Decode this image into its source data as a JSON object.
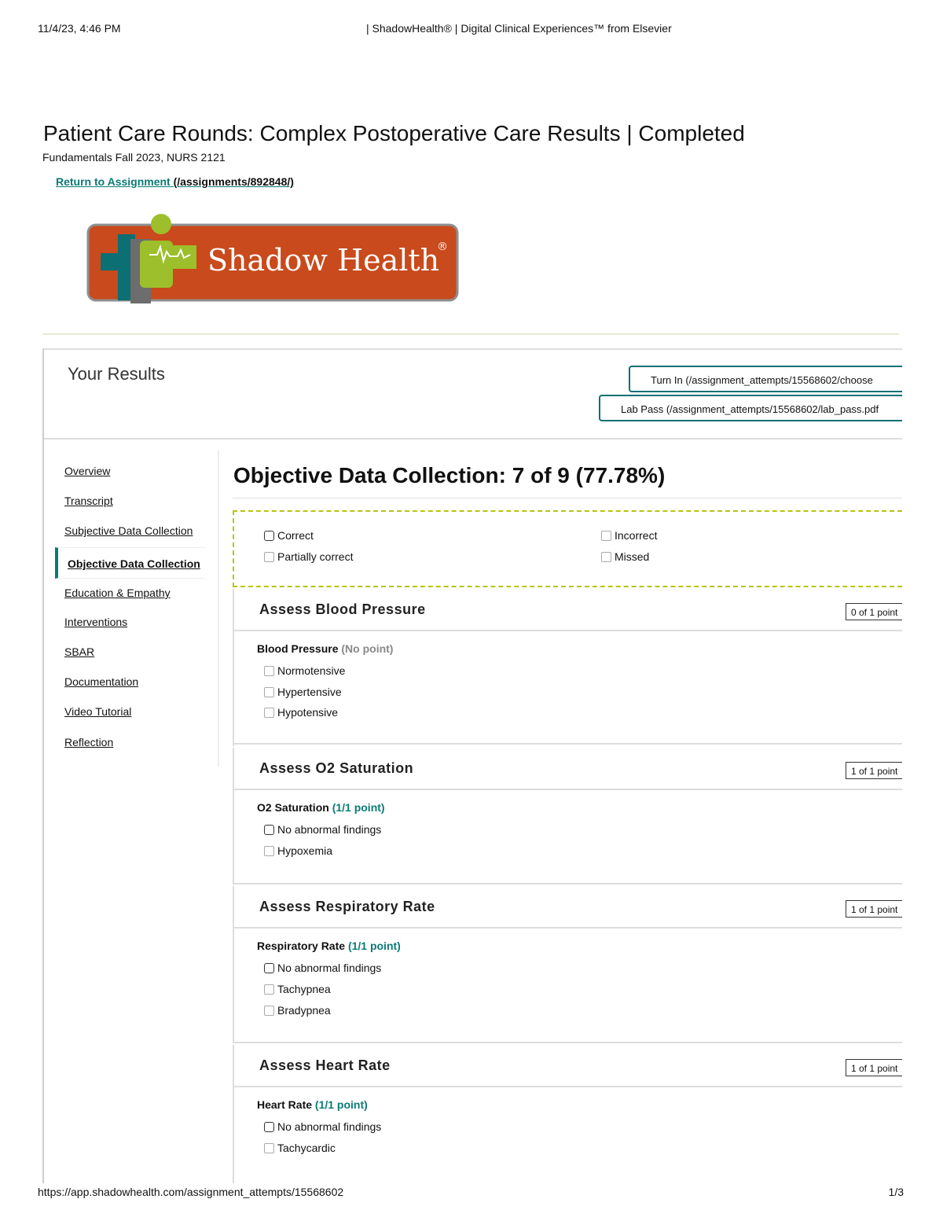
{
  "pdf_header": {
    "datetime": "11/4/23, 4:46 PM",
    "title": "| ShadowHealth® | Digital Clinical Experiences™ from Elsevier"
  },
  "pdf_footer": {
    "url": "https://app.shadowhealth.com/assignment_attempts/15568602",
    "page": "1/3"
  },
  "page": {
    "title": "Patient Care Rounds: Complex Postoperative Care Results | Completed",
    "course": "Fundamentals Fall 2023, NURS 2121",
    "return_link": {
      "label": "Return to Assignment",
      "href": " (/assignments/892848/)"
    }
  },
  "logo": {
    "text": "Shadow Health",
    "mark": "®",
    "colors": {
      "orange": "#c94a1c",
      "green": "#9cbf2b",
      "teal": "#0b6f73"
    }
  },
  "results": {
    "heading": "Your Results",
    "turn_in_button": "Turn In (/assignment_attempts/15568602/choose",
    "lab_pass_button": "Lab Pass (/assignment_attempts/15568602/lab_pass.pdf"
  },
  "nav": {
    "items": [
      "Overview",
      "Transcript",
      "Subjective Data Collection",
      "Objective Data Collection",
      "Education & Empathy",
      "Interventions",
      "SBAR",
      "Documentation",
      "Video Tutorial",
      "Reflection"
    ],
    "active": "Objective Data Collection"
  },
  "section": {
    "title": "Objective Data Collection: 7 of 9 (77.78%)"
  },
  "legend": {
    "correct": "Correct",
    "partially_correct": "Partially correct",
    "incorrect": "Incorrect",
    "missed": "Missed"
  },
  "cards": [
    {
      "title": "Assess Blood Pressure",
      "points": "0 of 1 point",
      "question": "Blood Pressure",
      "question_points": "(No point)",
      "options": [
        "Normotensive",
        "Hypertensive",
        "Hypotensive"
      ]
    },
    {
      "title": "Assess O2 Saturation",
      "points": "1 of 1 point",
      "question": "O2 Saturation",
      "question_points": "(1/1 point)",
      "options": [
        "No abnormal findings",
        "Hypoxemia"
      ]
    },
    {
      "title": "Assess Respiratory Rate",
      "points": "1 of 1 point",
      "question": "Respiratory Rate",
      "question_points": "(1/1 point)",
      "options": [
        "No abnormal findings",
        "Tachypnea",
        "Bradypnea"
      ]
    },
    {
      "title": "Assess Heart Rate",
      "points": "1 of 1 point",
      "question": "Heart Rate",
      "question_points": "(1/1 point)",
      "options": [
        "No abnormal findings",
        "Tachycardic"
      ]
    }
  ]
}
